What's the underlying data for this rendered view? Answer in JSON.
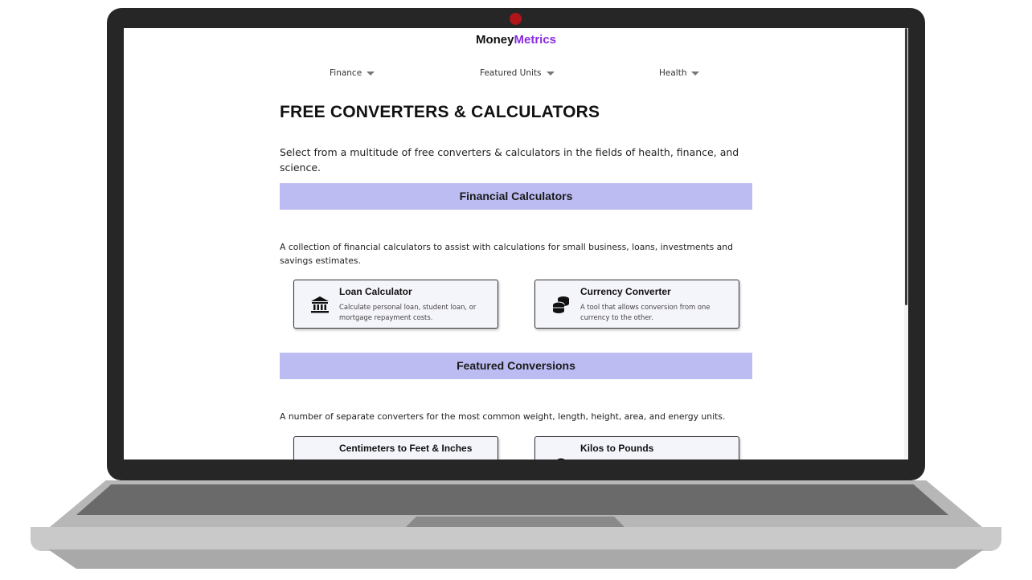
{
  "brand": {
    "part1": "Money",
    "part2": "Metrics",
    "accent_color": "#8a2be2"
  },
  "nav": {
    "items": [
      {
        "label": "Finance"
      },
      {
        "label": "Featured Units"
      },
      {
        "label": "Health"
      }
    ]
  },
  "main": {
    "title": "FREE CONVERTERS & CALCULATORS",
    "intro": "Select from a multitude of free converters & calculators in the fields of health, finance, and science.",
    "sections": [
      {
        "heading": "Financial Calculators",
        "description": "A collection of financial calculators to assist with calculations for small business, loans, investments and savings estimates.",
        "cards": [
          {
            "title": "Loan Calculator",
            "description": "Calculate personal loan, student loan, or mortgage repayment costs.",
            "icon": "bank-icon"
          },
          {
            "title": "Currency Converter",
            "description": "A tool that allows conversion from one currency to the other.",
            "icon": "coins-icon"
          }
        ]
      },
      {
        "heading": "Featured Conversions",
        "description": "A number of separate converters for the most common weight, length, height, area, and energy units.",
        "cards": [
          {
            "title": "Centimeters to Feet & Inches",
            "icon": "ruler-icon"
          },
          {
            "title": "Kilos to Pounds",
            "icon": "weight-icon"
          }
        ]
      }
    ]
  },
  "colors": {
    "section_bar": "#bcbcf2",
    "card_bg": "#f4f4fb",
    "laptop_bezel": "#262626"
  }
}
